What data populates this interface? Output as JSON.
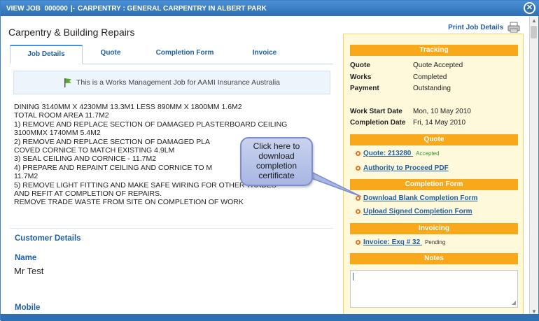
{
  "titlebar": {
    "view_job": "VIEW JOB",
    "job_number": "000000",
    "separator": "|-",
    "breadcrumb": "CARPENTRY : GENERAL CARPENTRY IN ALBERT PARK",
    "close_icon": "close-icon"
  },
  "page": {
    "title": "Carpentry & Building Repairs",
    "print_label": "Print Job Details",
    "print_icon": "printer-icon"
  },
  "tabs": [
    {
      "label": "Job Details",
      "active": true
    },
    {
      "label": "Quote",
      "active": false
    },
    {
      "label": "Completion Form",
      "active": false
    },
    {
      "label": "Invoice",
      "active": false
    }
  ],
  "notice": {
    "icon": "flag-icon",
    "text": "This is a Works Management Job for AAMI Insurance Australia"
  },
  "description": "DINING 3140MM X 4230MM 13.3M1 LESS 890MM X 1800MM 1.6M2\nTOTAL ROOM AREA 11.7M2\n1) REMOVE AND REPLACE SECTION OF DAMAGED PLASTERBOARD CEILING\n3100MMX 1740MM 5.4M2\n2) REMOVE AND REPLACE SECTION OF DAMAGED PLA\nCOVED CORNICE TO MATCH EXISTING 4.9LM\n3) SEAL CEILING AND CORNICE - 11.7M2\n4) PREPARE AND REPAINT CEILING AND CORNICE TO M\n11.7M2\n5) REMOVE LIGHT FITTING AND MAKE SAFE WIRING FOR OTHER TRADES\nAND REFIT AT COMPLETION OF REPAIRS.\nREMOVE TRADE WASTE FROM SITE ON COMPLETION OF WORK",
  "customer": {
    "section_title": "Customer Details",
    "name_label": "Name",
    "name_value": "Mr Test",
    "mobile_label": "Mobile"
  },
  "sidebar": {
    "tracking": {
      "title": "Tracking",
      "rows": [
        {
          "label": "Quote",
          "value": "Quote Accepted"
        },
        {
          "label": "Works",
          "value": "Completed"
        },
        {
          "label": "Payment",
          "value": "Outstanding"
        }
      ],
      "dates": [
        {
          "label": "Work Start Date",
          "value": "Mon, 10 May 2010"
        },
        {
          "label": "Completion Date",
          "value": "Fri, 14 May 2010"
        }
      ]
    },
    "quote": {
      "title": "Quote",
      "link1": "Quote: 213280",
      "link1_badge": "Accepted",
      "link2": "Authority to Proceed PDF"
    },
    "completion_form": {
      "title": "Completion Form",
      "link1": "Download Blank Completion Form",
      "link2": "Upload Signed Completion Form"
    },
    "invoicing": {
      "title": "Invoicing",
      "link1": "Invoice: Exq # 32",
      "link1_badge": "Pending"
    },
    "notes": {
      "title": "Notes",
      "value": ""
    }
  },
  "callout": {
    "text": "Click here to download completion certificate"
  },
  "colors": {
    "titlebar": "#2f6fb3",
    "accent_orange": "#f7a81b",
    "link_blue": "#1f5fa5",
    "accepted_green": "#2d9a2d"
  }
}
